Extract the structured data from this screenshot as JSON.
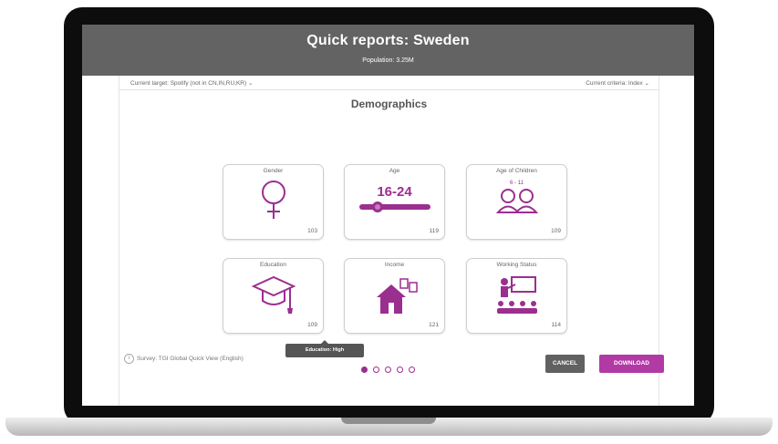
{
  "header": {
    "title": "Quick reports: Sweden",
    "subtitle": "Population: 3.25M"
  },
  "filters": {
    "current_target": "Current target: Spotify (not in CN,IN,RU,KR)",
    "current_criteria": "Current criteria: Index"
  },
  "section": {
    "title": "Demographics"
  },
  "cards": [
    {
      "label": "Gender",
      "value": "103",
      "icon": "female-symbol-icon"
    },
    {
      "label": "Age",
      "value": "119",
      "range": "16-24",
      "icon": "age-slider-icon"
    },
    {
      "label": "Age of Children",
      "value": "109",
      "range": "6 - 11",
      "icon": "children-icon"
    },
    {
      "label": "Education",
      "value": "109",
      "icon": "graduation-cap-icon"
    },
    {
      "label": "Income",
      "value": "121",
      "icon": "house-income-icon"
    },
    {
      "label": "Working Status",
      "value": "114",
      "icon": "presentation-icon"
    }
  ],
  "tooltip": {
    "text": "Education: High"
  },
  "survey": {
    "text": "Survey: TGI Global Quick View (English)"
  },
  "pagination": {
    "total": 5,
    "active": 1
  },
  "buttons": {
    "cancel": "CANCEL",
    "download": "DOWNLOAD"
  },
  "colors": {
    "accent": "#9b2f8f",
    "header_bg": "#636363",
    "button_dark": "#616161",
    "button_primary": "#b23aa5"
  }
}
